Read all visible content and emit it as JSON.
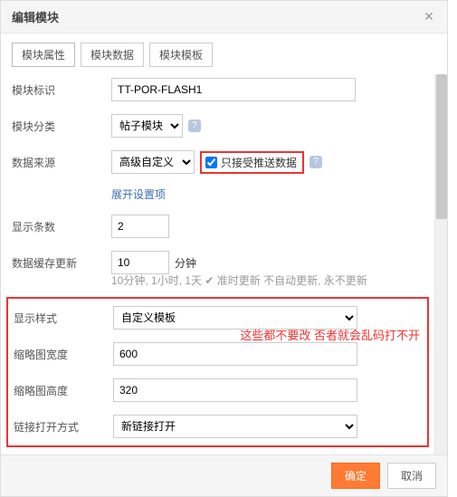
{
  "dialog": {
    "title": "编辑模块"
  },
  "tabs": {
    "attr": "模块属性",
    "data": "模块数据",
    "tmpl": "模块模板"
  },
  "labels": {
    "id": "模块标识",
    "category": "模块分类",
    "source": "数据来源",
    "expand": "展开设置项",
    "count": "显示条数",
    "cache": "数据缓存更新",
    "minutes": "分钟",
    "style": "显示样式",
    "thumbW": "缩略图宽度",
    "thumbH": "缩略图高度",
    "linkOpen": "链接打开方式"
  },
  "values": {
    "id": "TT-POR-FLASH1",
    "category": "帖子模块",
    "source": "高级自定义",
    "pushOnly": "只接受推送数据",
    "pushChecked": true,
    "count": "2",
    "cache": "10",
    "cacheHint": "10分钟, 1小时, 1天   ✔ 准时更新     不自动更新, 永不更新",
    "style": "自定义模板",
    "thumbW": "600",
    "thumbH": "320",
    "linkOpen": "新链接打开"
  },
  "annotation": "这些都不要改  否者就会乱码打不开",
  "footer": {
    "ok": "确定",
    "cancel": "取消"
  },
  "icons": {
    "help": "?"
  }
}
